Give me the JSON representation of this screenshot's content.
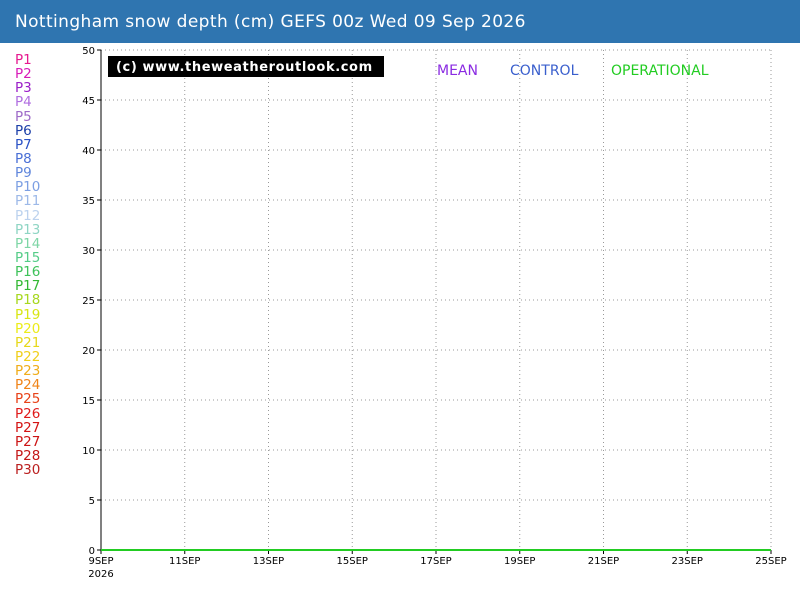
{
  "title": "Nottingham snow depth (cm) GEFS 00z Wed 09 Sep 2026",
  "watermark": "(c) www.theweatheroutlook.com",
  "colors": {
    "header_bg": "#2f75b0",
    "mean": "#8a2be2",
    "control": "#3a5fcd",
    "operational": "#22cc22",
    "grid": "#999999"
  },
  "perturbations": [
    {
      "label": "P1",
      "color": "#e6198f"
    },
    {
      "label": "P2",
      "color": "#d81bb8"
    },
    {
      "label": "P3",
      "color": "#9b1fc8"
    },
    {
      "label": "P4",
      "color": "#b06ee0"
    },
    {
      "label": "P5",
      "color": "#9e6bc8"
    },
    {
      "label": "P6",
      "color": "#1c3fa8"
    },
    {
      "label": "P7",
      "color": "#2b52c6"
    },
    {
      "label": "P8",
      "color": "#4a6fd6"
    },
    {
      "label": "P9",
      "color": "#5f86dc"
    },
    {
      "label": "P10",
      "color": "#7c9fe3"
    },
    {
      "label": "P11",
      "color": "#9db9e8"
    },
    {
      "label": "P12",
      "color": "#bcd2ee"
    },
    {
      "label": "P13",
      "color": "#8fd5c4"
    },
    {
      "label": "P14",
      "color": "#7ed6a6"
    },
    {
      "label": "P15",
      "color": "#55cc88"
    },
    {
      "label": "P16",
      "color": "#3ec25a"
    },
    {
      "label": "P17",
      "color": "#33b833"
    },
    {
      "label": "P18",
      "color": "#a8d820"
    },
    {
      "label": "P19",
      "color": "#d8e614"
    },
    {
      "label": "P20",
      "color": "#ecec1a"
    },
    {
      "label": "P21",
      "color": "#e6d81a"
    },
    {
      "label": "P22",
      "color": "#f0cf1a"
    },
    {
      "label": "P23",
      "color": "#f0ad1a"
    },
    {
      "label": "P24",
      "color": "#f08418"
    },
    {
      "label": "P25",
      "color": "#e84218"
    },
    {
      "label": "P26",
      "color": "#e01a1a"
    },
    {
      "label": "P27",
      "color": "#d41414"
    },
    {
      "label": "P27",
      "color": "#cc1414"
    },
    {
      "label": "P28",
      "color": "#c41818"
    },
    {
      "label": "P30",
      "color": "#bb2020"
    }
  ],
  "chart_data": {
    "type": "line",
    "y_ticks": [
      "0",
      "5",
      "10",
      "15",
      "20",
      "25",
      "30",
      "35",
      "40",
      "45",
      "50"
    ],
    "x_ticks": [
      "9SEP",
      "11SEP",
      "13SEP",
      "15SEP",
      "17SEP",
      "19SEP",
      "21SEP",
      "23SEP",
      "25SEP"
    ],
    "x_year": "2026",
    "ylim": [
      0,
      50
    ],
    "grid": true,
    "series": [
      {
        "name": "MEAN",
        "color": "#8a2be2",
        "values": [
          0,
          0,
          0,
          0,
          0,
          0,
          0,
          0,
          0
        ]
      },
      {
        "name": "CONTROL",
        "color": "#3a5fcd",
        "values": [
          0,
          0,
          0,
          0,
          0,
          0,
          0,
          0,
          0
        ]
      },
      {
        "name": "OPERATIONAL",
        "color": "#22cc22",
        "values": [
          0,
          0,
          0,
          0,
          0,
          0,
          0,
          0,
          0
        ]
      }
    ]
  }
}
